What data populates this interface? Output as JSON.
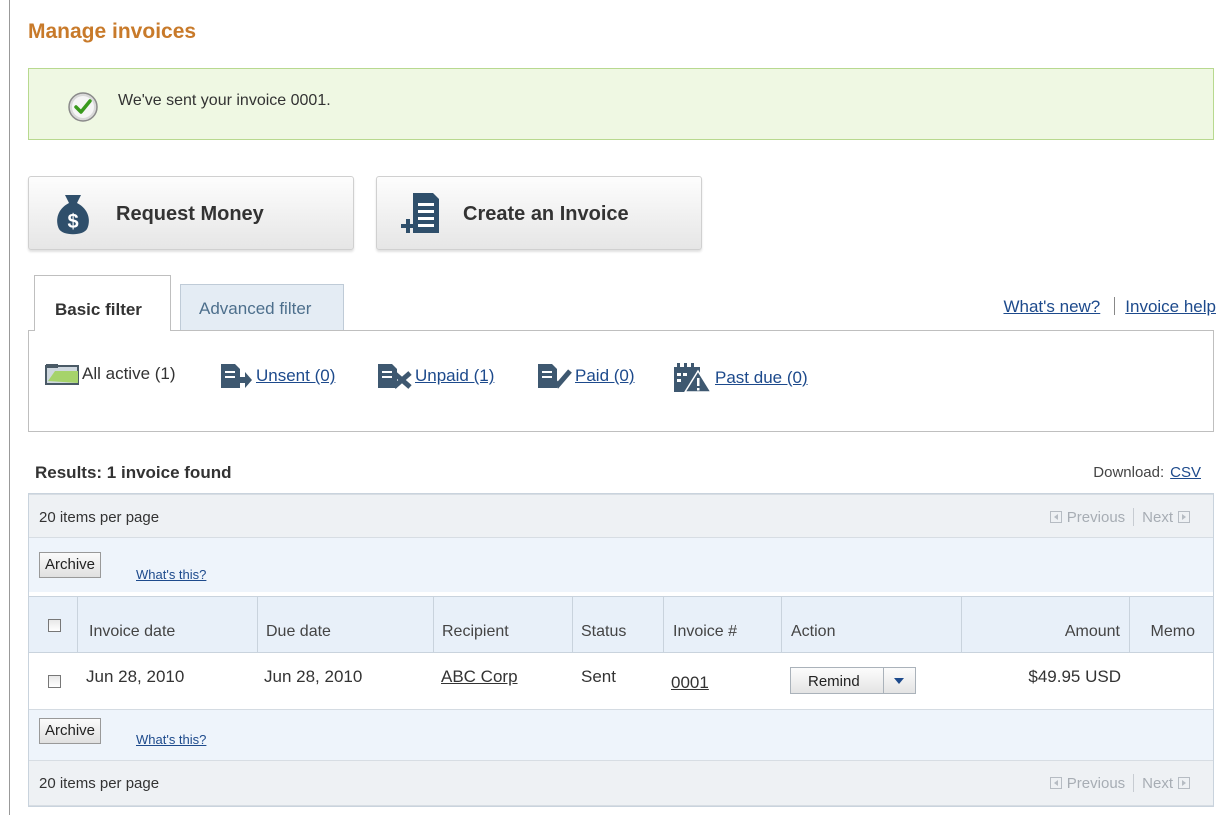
{
  "page": {
    "title": "Manage invoices",
    "success_message": "We've sent your invoice 0001."
  },
  "buttons": {
    "request_money": "Request Money",
    "create_invoice": "Create an Invoice"
  },
  "tabs": {
    "basic": "Basic filter",
    "advanced": "Advanced filter"
  },
  "top_links": {
    "whats_new": "What's new?",
    "invoice_help": "Invoice help"
  },
  "filters": {
    "all_active": "All active (1)",
    "unsent": "Unsent (0)",
    "unpaid": "Unpaid (1)",
    "paid": "Paid (0)",
    "past_due": "Past due (0)"
  },
  "results": {
    "summary": "Results: 1 invoice found",
    "download_label": "Download:",
    "csv": "CSV"
  },
  "pager": {
    "items_per_page": "20 items per page",
    "previous": "Previous",
    "next": "Next"
  },
  "actions": {
    "archive": "Archive",
    "whats_this": "What's this?"
  },
  "table": {
    "headers": {
      "invoice_date": "Invoice date",
      "due_date": "Due date",
      "recipient": "Recipient",
      "status": "Status",
      "invoice_num": "Invoice #",
      "action": "Action",
      "amount": "Amount",
      "memo": "Memo"
    },
    "rows": [
      {
        "invoice_date": "Jun 28, 2010",
        "due_date": "Jun 28, 2010",
        "recipient": "ABC Corp",
        "status": "Sent",
        "invoice_num": "0001",
        "action": "Remind",
        "amount": "$49.95 USD",
        "memo": ""
      }
    ]
  },
  "colors": {
    "title": "#c87a2a",
    "success_bg": "#eff8e3",
    "success_border": "#b8d98f",
    "link": "#1d4a8c",
    "table_header_bg": "#e8f0f9"
  },
  "icons": {
    "success": "check-circle-icon",
    "request_money": "money-bag-icon",
    "create_invoice": "new-document-icon",
    "all_active": "folder-icon",
    "unsent": "document-arrow-icon",
    "unpaid": "document-x-icon",
    "paid": "document-check-icon",
    "past_due": "calendar-warning-icon"
  }
}
